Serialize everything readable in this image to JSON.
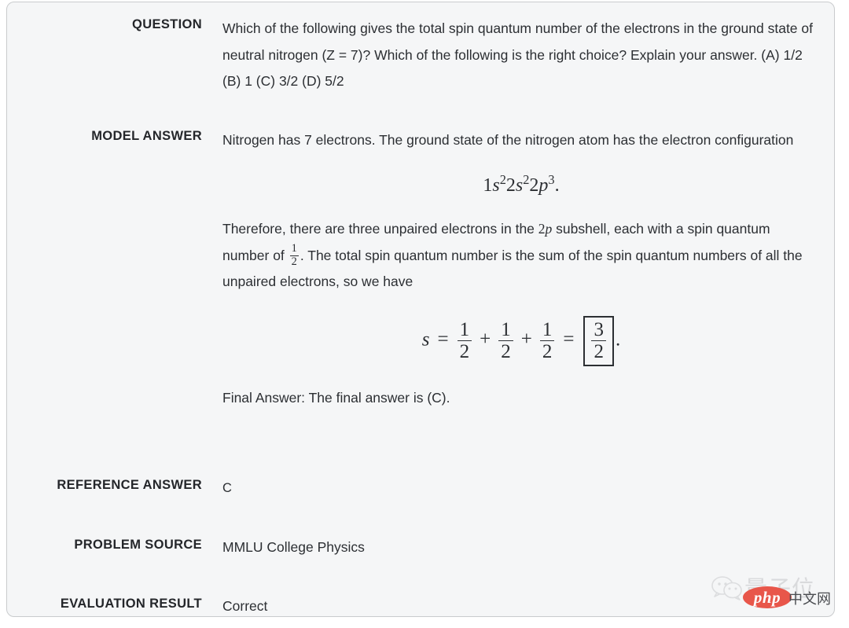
{
  "card": {
    "background": "#f5f6f7",
    "border_color": "#c9cbcd",
    "text_color": "#2c2f33"
  },
  "rows": {
    "question": {
      "label": "QUESTION",
      "text": "Which of the following gives the total spin quantum number of the electrons in the ground state of neutral nitrogen (Z = 7)? Which of the following is the right choice? Explain your answer. (A) 1/2 (B) 1 (C) 3/2 (D) 5/2"
    },
    "model_answer": {
      "label": "MODEL ANSWER",
      "paragraph_1": "Nitrogen has 7 electrons. The ground state of the nitrogen atom has the electron configuration",
      "equation_1": {
        "latex": "1s^{2}2s^{2}2p^{3}.",
        "parts": {
          "a_base": "1",
          "a_var": "s",
          "a_exp": "2",
          "b_base": "2",
          "b_var": "s",
          "b_exp": "2",
          "c_base": "2",
          "c_var": "p",
          "c_exp": "3",
          "period": "."
        }
      },
      "paragraph_2_a": "Therefore, there are three unpaired electrons in the",
      "paragraph_2_math_1": {
        "base": "2",
        "var": "p"
      },
      "paragraph_2_b": "subshell, each with a spin quantum number of",
      "paragraph_2_frac": {
        "num": "1",
        "den": "2"
      },
      "paragraph_2_c": ". The total spin quantum number is the sum of the spin quantum numbers of all the unpaired electrons, so we have",
      "equation_2": {
        "latex": "s = \\frac{1}{2} + \\frac{1}{2} + \\frac{1}{2} = \\boxed{\\frac{3}{2}}.",
        "variable": "s",
        "equals": "=",
        "plus": "+",
        "terms": [
          {
            "num": "1",
            "den": "2"
          },
          {
            "num": "1",
            "den": "2"
          },
          {
            "num": "1",
            "den": "2"
          }
        ],
        "result": {
          "num": "3",
          "den": "2"
        },
        "period": "."
      },
      "paragraph_3": "Final Answer: The final answer is (C)."
    },
    "reference_answer": {
      "label": "REFERENCE ANSWER",
      "value": "C"
    },
    "problem_source": {
      "label": "PROBLEM SOURCE",
      "value": "MMLU College Physics"
    },
    "evaluation_result": {
      "label": "EVALUATION RESULT",
      "value": "Correct"
    }
  },
  "watermark": {
    "wechat_icon": "wechat-bubbles-icon",
    "brand": "量子位",
    "badge": "php",
    "suffix": "中文网",
    "badge_color": "#e8564a"
  }
}
